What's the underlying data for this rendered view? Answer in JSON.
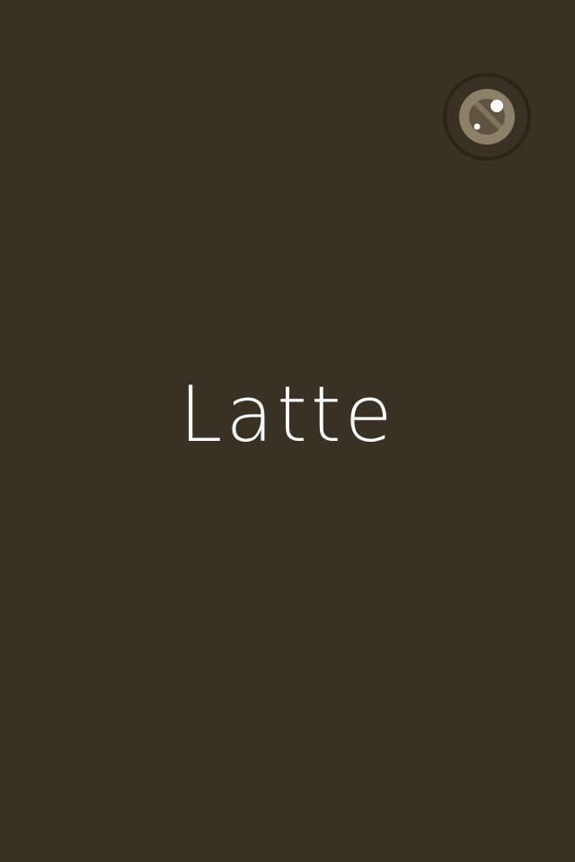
{
  "screen": {
    "title": "Latte",
    "background_color": "#383124",
    "text_color": "#FFFFFF"
  },
  "lens_button": {
    "icon": "camera-lens-icon",
    "ring_color": "#2A2419",
    "lens_color": "#8D8068",
    "highlight_color": "#FFFFFF"
  }
}
